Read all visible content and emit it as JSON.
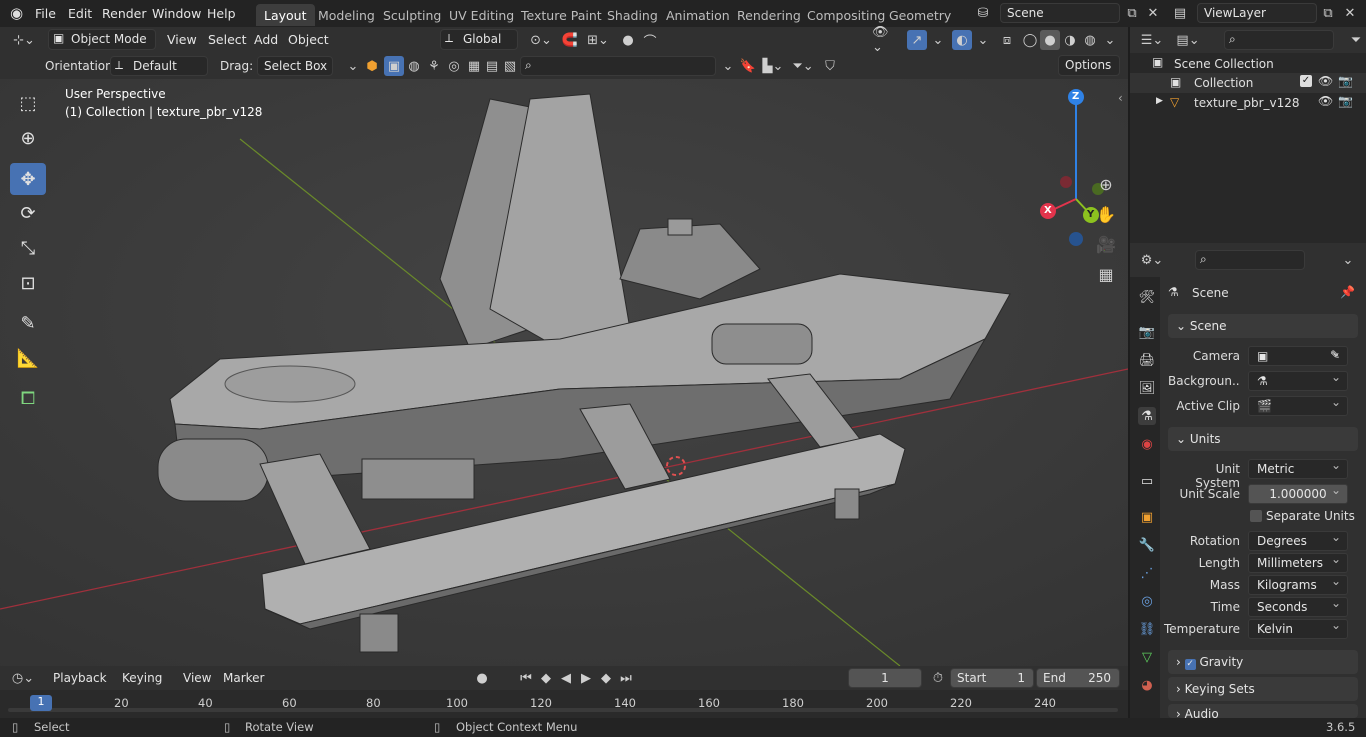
{
  "menu": [
    "File",
    "Edit",
    "Render",
    "Window",
    "Help"
  ],
  "workspaces": [
    "Layout",
    "Modeling",
    "Sculpting",
    "UV Editing",
    "Texture Paint",
    "Shading",
    "Animation",
    "Rendering",
    "Compositing",
    "Geometry Noc"
  ],
  "scene_field": "Scene",
  "viewlayer_field": "ViewLayer",
  "vp_header": {
    "mode": "Object Mode",
    "view": "View",
    "select": "Select",
    "add": "Add",
    "object": "Object",
    "transform": "Global"
  },
  "tool_header": {
    "orientation_label": "Orientation:",
    "orientation_value": "Default",
    "drag_label": "Drag:",
    "drag_value": "Select Box",
    "options": "Options"
  },
  "viewport": {
    "title": "User Perspective",
    "subtitle": "(1) Collection | texture_pbr_v128"
  },
  "gizmo": {
    "x": "X",
    "y": "Y",
    "z": "Z"
  },
  "outliner": {
    "root": "Scene Collection",
    "collection": "Collection",
    "object": "texture_pbr_v128"
  },
  "properties": {
    "context": "Scene",
    "scene_panel": "Scene",
    "camera_label": "Camera",
    "background_label": "Backgroun...",
    "clip_label": "Active Clip",
    "units_panel": "Units",
    "unit_system_label": "Unit System",
    "unit_system": "Metric",
    "unit_scale_label": "Unit Scale",
    "unit_scale": "1.000000",
    "separate_units": "Separate Units",
    "rotation_label": "Rotation",
    "rotation": "Degrees",
    "length_label": "Length",
    "length": "Millimeters",
    "mass_label": "Mass",
    "mass": "Kilograms",
    "time_label": "Time",
    "time": "Seconds",
    "temperature_label": "Temperature",
    "temperature": "Kelvin",
    "gravity": "Gravity",
    "keying_sets": "Keying Sets",
    "audio": "Audio"
  },
  "timeline": {
    "playback": "Playback",
    "keying": "Keying",
    "view": "View",
    "marker": "Marker",
    "current_frame": "1",
    "start_label": "Start",
    "start": "1",
    "end_label": "End",
    "end": "250",
    "ticks": [
      "1",
      "20",
      "40",
      "60",
      "80",
      "100",
      "120",
      "140",
      "160",
      "180",
      "200",
      "220",
      "240"
    ]
  },
  "status": {
    "select": "Select",
    "rotate": "Rotate View",
    "context": "Object Context Menu",
    "version": "3.6.5"
  },
  "colors": {
    "accent": "#4772b3",
    "x_axis": "#e2344c",
    "y_axis": "#8cc21f",
    "z_axis": "#2f82e6"
  }
}
